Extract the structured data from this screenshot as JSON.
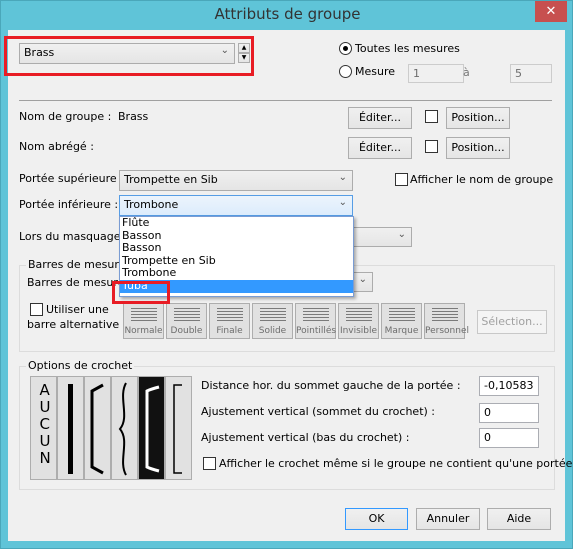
{
  "window": {
    "title": "Attributs de groupe",
    "close": "✕"
  },
  "group_select": {
    "value": "Brass"
  },
  "range": {
    "all_label": "Toutes les mesures",
    "measure_label": "Mesure",
    "from": "1",
    "to_label": "à",
    "to": "5",
    "selected": "all"
  },
  "name": {
    "label": "Nom de groupe :",
    "value": "Brass",
    "edit": "Éditer...",
    "position": "Position..."
  },
  "abbr": {
    "label": "Nom abrégé :",
    "edit": "Éditer...",
    "position": "Position..."
  },
  "top_staff": {
    "label": "Portée supérieure :",
    "value": "Trompette en Sib"
  },
  "show_name": {
    "label": "Afficher le nom de groupe",
    "checked": false
  },
  "bottom_staff": {
    "label": "Portée inférieure :",
    "value": "Trombone",
    "options": [
      "Flûte",
      "Basson",
      "Basson",
      "Trompette en Sib",
      "Trombone",
      "Tuba"
    ],
    "highlighted": "Tuba"
  },
  "hide": {
    "label": "Lors du masquage de"
  },
  "barlines": {
    "title": "Barres de mesure",
    "label": "Barres de mesure",
    "alt_line1": "Utiliser une",
    "alt_line2": "barre alternative",
    "types": [
      "Normale",
      "Double",
      "Finale",
      "Solide",
      "Pointillés",
      "Invisible",
      "Marque",
      "Personnel"
    ],
    "selection": "Sélection..."
  },
  "bracket": {
    "title": "Options de crochet",
    "none_label": "AUCUN",
    "selected_index": 4,
    "dist_label": "Distance hor. du sommet gauche de la portée :",
    "dist": "-0,10583",
    "top_label": "Ajustement vertical (sommet du crochet) :",
    "top": "0",
    "bottom_label": "Ajustement vertical (bas du crochet) :",
    "bottom": "0",
    "single_label": "Afficher le crochet même si le groupe ne contient qu'une portée"
  },
  "buttons": {
    "ok": "OK",
    "cancel": "Annuler",
    "help": "Aide"
  },
  "colors": {
    "frame": "#5fc4d8",
    "highlight": "#3399ff",
    "annotation": "#e81c24"
  }
}
